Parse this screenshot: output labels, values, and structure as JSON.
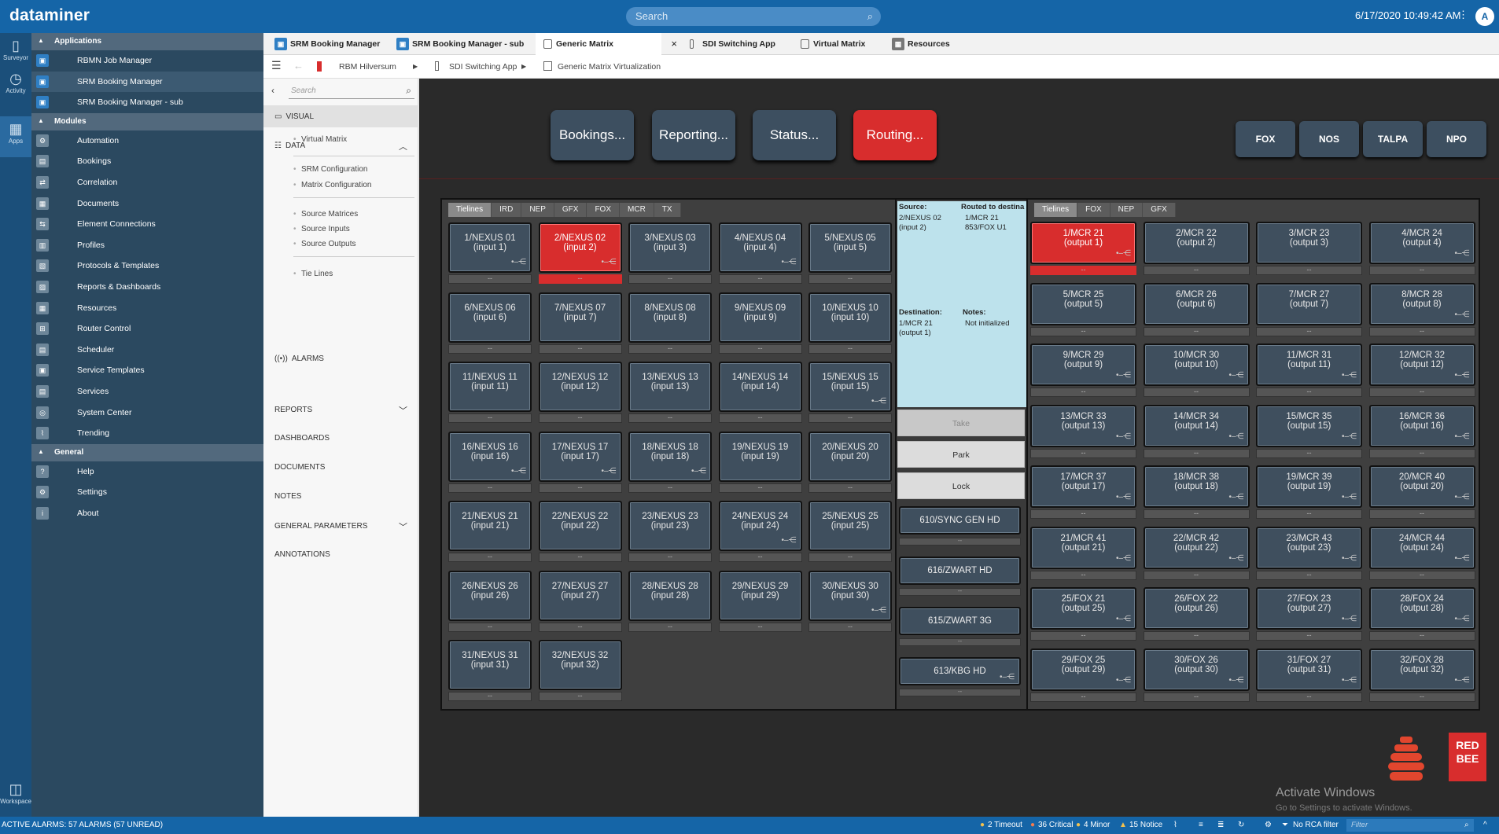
{
  "topbar": {
    "logo": "dataminer",
    "search_placeholder": "Search",
    "datetime": "6/17/2020 10:49:42 AM",
    "avatar": "A",
    "menu_icon": "⋮"
  },
  "rail": {
    "items": [
      {
        "label": "Surveyor",
        "icon": "surveyor-icon"
      },
      {
        "label": "Activity",
        "icon": "history-icon"
      },
      {
        "label": "Apps",
        "icon": "apps-icon"
      }
    ],
    "workspace": "Workspace"
  },
  "sidenav": {
    "applications_title": "Applications",
    "applications": [
      "RBMN Job Manager",
      "SRM Booking Manager",
      "SRM Booking Manager - sub"
    ],
    "modules_title": "Modules",
    "modules": [
      "Automation",
      "Bookings",
      "Correlation",
      "Documents",
      "Element Connections",
      "Profiles",
      "Protocols & Templates",
      "Reports & Dashboards",
      "Resources",
      "Router Control",
      "Scheduler",
      "Service Templates",
      "Services",
      "System Center",
      "Trending"
    ],
    "general_title": "General",
    "general": [
      "Help",
      "Settings",
      "About"
    ]
  },
  "tabs": [
    "SRM Booking Manager",
    "SRM Booking Manager - sub",
    "Generic Matrix Virtualization",
    "SDI Switching App",
    "Virtual Matrix",
    "Resources"
  ],
  "breadcrumb": {
    "b1": "RBM Hilversum",
    "b2": "SDI Switching App",
    "b3": "Generic Matrix Virtualization"
  },
  "viewpanel": {
    "search_placeholder": "Search",
    "visual": "VISUAL",
    "data": "DATA",
    "data_items": [
      "Virtual Matrix",
      "SRM Configuration",
      "Matrix Configuration",
      "Source Matrices",
      "Source Inputs",
      "Source Outputs",
      "Tie Lines"
    ],
    "alarms": "ALARMS",
    "reports": "REPORTS",
    "dashboards": "DASHBOARDS",
    "documents": "DOCUMENTS",
    "notes": "NOTES",
    "general_parameters": "GENERAL PARAMETERS",
    "annotations": "ANNOTATIONS"
  },
  "buttons": {
    "bookings": "Bookings...",
    "reporting": "Reporting...",
    "status": "Status...",
    "routing": "Routing...",
    "fox": "FOX",
    "nos": "NOS",
    "talpa": "TALPA",
    "npo": "NPO"
  },
  "source_tabs": [
    "Tielines",
    "IRD",
    "NEP",
    "GFX",
    "FOX",
    "MCR",
    "TX"
  ],
  "dest_tabs": [
    "Tielines",
    "FOX",
    "NEP",
    "GFX"
  ],
  "inputs": [
    [
      "1/NEXUS 01",
      "(input 1)"
    ],
    [
      "2/NEXUS 02",
      "(input 2)"
    ],
    [
      "3/NEXUS 03",
      "(input 3)"
    ],
    [
      "4/NEXUS 04",
      "(input 4)"
    ],
    [
      "5/NEXUS 05",
      "(input 5)"
    ],
    [
      "6/NEXUS 06",
      "(input 6)"
    ],
    [
      "7/NEXUS 07",
      "(input 7)"
    ],
    [
      "8/NEXUS 08",
      "(input 8)"
    ],
    [
      "9/NEXUS 09",
      "(input 9)"
    ],
    [
      "10/NEXUS 10",
      "(input 10)"
    ],
    [
      "11/NEXUS 11",
      "(input 11)"
    ],
    [
      "12/NEXUS 12",
      "(input 12)"
    ],
    [
      "13/NEXUS 13",
      "(input 13)"
    ],
    [
      "14/NEXUS 14",
      "(input 14)"
    ],
    [
      "15/NEXUS 15",
      "(input 15)"
    ],
    [
      "16/NEXUS 16",
      "(input 16)"
    ],
    [
      "17/NEXUS 17",
      "(input 17)"
    ],
    [
      "18/NEXUS 18",
      "(input 18)"
    ],
    [
      "19/NEXUS 19",
      "(input 19)"
    ],
    [
      "20/NEXUS 20",
      "(input 20)"
    ],
    [
      "21/NEXUS 21",
      "(input 21)"
    ],
    [
      "22/NEXUS 22",
      "(input 22)"
    ],
    [
      "23/NEXUS 23",
      "(input 23)"
    ],
    [
      "24/NEXUS 24",
      "(input 24)"
    ],
    [
      "25/NEXUS 25",
      "(input 25)"
    ],
    [
      "26/NEXUS 26",
      "(input 26)"
    ],
    [
      "27/NEXUS 27",
      "(input 27)"
    ],
    [
      "28/NEXUS 28",
      "(input 28)"
    ],
    [
      "29/NEXUS 29",
      "(input 29)"
    ],
    [
      "30/NEXUS 30",
      "(input 30)"
    ],
    [
      "31/NEXUS 31",
      "(input 31)"
    ],
    [
      "32/NEXUS 32",
      "(input 32)"
    ]
  ],
  "outputs": [
    [
      "1/MCR 21",
      "(output 1)"
    ],
    [
      "2/MCR 22",
      "(output 2)"
    ],
    [
      "3/MCR 23",
      "(output 3)"
    ],
    [
      "4/MCR 24",
      "(output 4)"
    ],
    [
      "5/MCR 25",
      "(output 5)"
    ],
    [
      "6/MCR 26",
      "(output 6)"
    ],
    [
      "7/MCR 27",
      "(output 7)"
    ],
    [
      "8/MCR 28",
      "(output 8)"
    ],
    [
      "9/MCR 29",
      "(output 9)"
    ],
    [
      "10/MCR 30",
      "(output 10)"
    ],
    [
      "11/MCR 31",
      "(output 11)"
    ],
    [
      "12/MCR 32",
      "(output 12)"
    ],
    [
      "13/MCR 33",
      "(output 13)"
    ],
    [
      "14/MCR 34",
      "(output 14)"
    ],
    [
      "15/MCR 35",
      "(output 15)"
    ],
    [
      "16/MCR 36",
      "(output 16)"
    ],
    [
      "17/MCR 37",
      "(output 17)"
    ],
    [
      "18/MCR 38",
      "(output 18)"
    ],
    [
      "19/MCR 39",
      "(output 19)"
    ],
    [
      "20/MCR 40",
      "(output 20)"
    ],
    [
      "21/MCR 41",
      "(output 21)"
    ],
    [
      "22/MCR 42",
      "(output 22)"
    ],
    [
      "23/MCR 43",
      "(output 23)"
    ],
    [
      "24/MCR 44",
      "(output 24)"
    ],
    [
      "25/FOX 21",
      "(output 25)"
    ],
    [
      "26/FOX 22",
      "(output 26)"
    ],
    [
      "27/FOX 23",
      "(output 27)"
    ],
    [
      "28/FOX 24",
      "(output 28)"
    ],
    [
      "29/FOX 25",
      "(output 29)"
    ],
    [
      "30/FOX 26",
      "(output 30)"
    ],
    [
      "31/FOX 27",
      "(output 31)"
    ],
    [
      "32/FOX 28",
      "(output 32)"
    ]
  ],
  "selected_input": 2,
  "selected_output": 1,
  "bar_text": "--",
  "info": {
    "source_label": "Source:",
    "source_value": "2/NEXUS 02 (input 2)",
    "routed_label": "Routed to destina",
    "routed_value": "1/MCR 21 853/FOX U1",
    "dest_label": "Destination:",
    "dest_value": "1/MCR 21 (output 1)",
    "notes_label": "Notes:",
    "notes_value": "Not initialized"
  },
  "actions": {
    "take": "Take",
    "park": "Park",
    "lock": "Lock"
  },
  "tielines": [
    "610/SYNC GEN HD",
    "616/ZWART HD",
    "615/ZWART 3G",
    "613/KBG HD"
  ],
  "logo_text": "RED BEE",
  "watermark": {
    "title": "Activate Windows",
    "sub": "Go to Settings to activate Windows."
  },
  "status": {
    "alarms": "ACTIVE ALARMS: 57 ALARMS (57 UNREAD)",
    "timeout": "2 Timeout",
    "critical": "36 Critical",
    "minor": "4 Minor",
    "notice": "15 Notice",
    "rca": "No RCA filter",
    "filter_placeholder": "Filter"
  },
  "colors": {
    "accent": "#1565a7",
    "selected": "#d82d2d",
    "tile": "#3f4f5e"
  }
}
